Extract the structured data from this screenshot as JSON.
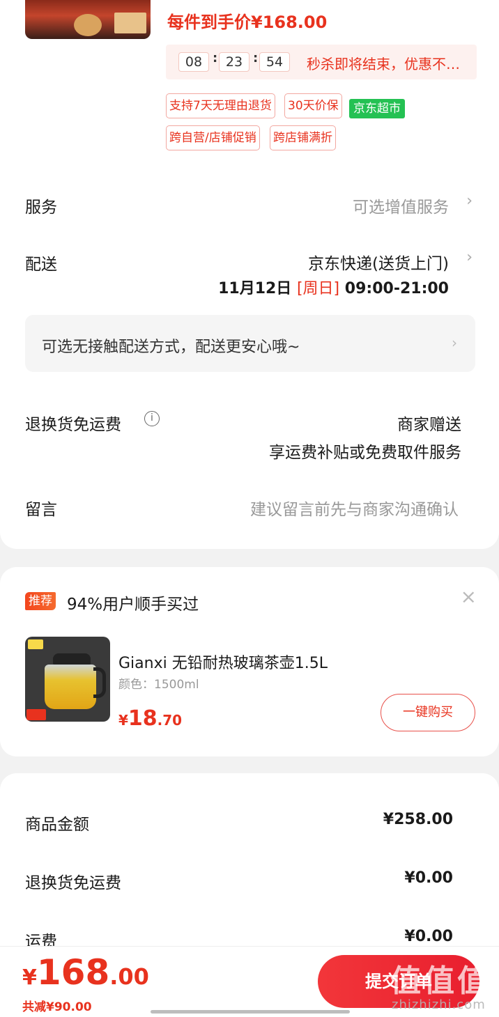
{
  "product": {
    "final_price": "每件到手价¥168.00",
    "countdown": {
      "hours": "08",
      "minutes": "23",
      "seconds": "54",
      "sep": ":"
    },
    "seckill_text": "秒杀即将结束，优惠不…",
    "tags": [
      "支持7天无理由退货",
      "30天价保",
      "跨自营/店铺促销",
      "跨店铺满折"
    ],
    "tag_green": "京东超市"
  },
  "service": {
    "label": "服务",
    "value": "可选增值服务",
    "chevron": "›"
  },
  "delivery": {
    "label": "配送",
    "method": "京东快递(送货上门)",
    "date": "11月12日 ",
    "weekday": "[周日]",
    "time": " 09:00-21:00",
    "chevron": "›"
  },
  "contactless": {
    "text": "可选无接触配送方式，配送更安心哦~",
    "chevron": "›"
  },
  "return_shipping": {
    "label": "退换货免运费",
    "info_icon": "i",
    "value1": "商家赠送",
    "value2": "享运费补贴或免费取件服务"
  },
  "message": {
    "label": "留言",
    "placeholder": "建议留言前先与商家沟通确认"
  },
  "recommend": {
    "badge": "推荐",
    "title": "94%用户顺手买过",
    "close": "×",
    "item": {
      "name": "Gianxi 无铅耐热玻璃茶壶1.5L",
      "spec": "颜色：1500ml",
      "price_symbol": "¥",
      "price_int": "18",
      "price_dec": ".70",
      "buy_label": "一键购买"
    }
  },
  "summary": [
    {
      "label": "商品金额",
      "value": "¥258.00"
    },
    {
      "label": "退换货免运费",
      "value": "¥0.00"
    },
    {
      "label": "运费",
      "value": "¥0.00"
    }
  ],
  "bottom": {
    "symbol": "¥",
    "int": "168",
    "dec": ".00",
    "saved": "共减¥90.00",
    "submit": "提交订单"
  },
  "watermark": {
    "chars": [
      "值",
      "值",
      "值"
    ],
    "url": "zhizhizhi.com"
  },
  "colors": {
    "accent": "#e8321e",
    "green": "#24c153"
  }
}
